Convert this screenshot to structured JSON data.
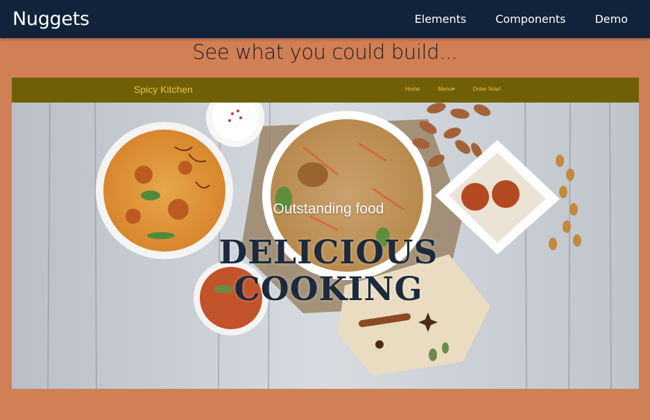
{
  "topbar": {
    "brand": "Nuggets",
    "nav": [
      "Elements",
      "Components",
      "Demo"
    ]
  },
  "heading": "See what you could build...",
  "demo": {
    "brand": "Spicy Kitchen",
    "nav": [
      "Home",
      "Menu▾",
      "Order Now!"
    ],
    "hero_subtitle": "Outstanding food",
    "hero_title_line1": "DELICIOUS",
    "hero_title_line2": "COOKING"
  },
  "colors": {
    "page_bg": "#d17f55",
    "topbar_bg": "#10233a",
    "demo_nav_bg": "#6f5f06",
    "demo_nav_text": "#e9c23c",
    "hero_title": "#1b2a3c"
  }
}
